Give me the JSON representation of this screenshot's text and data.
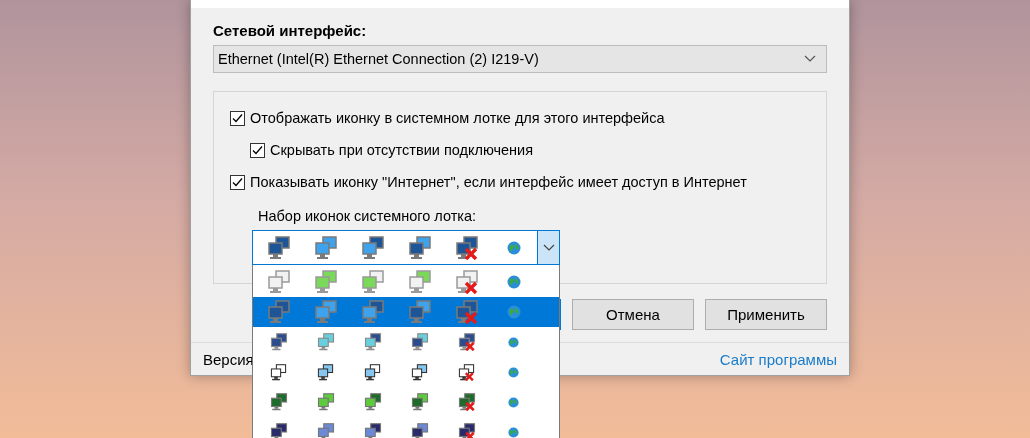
{
  "interface_section": {
    "label": "Сетевой интерфейс:",
    "select": {
      "value": "Ethernet (Intel(R) Ethernet Connection (2) I219-V)"
    }
  },
  "options": [
    {
      "label": "Отображать иконку в системном лотке для этого интерфейса",
      "checked": true,
      "children": [
        {
          "label": "Скрывать при отсутствии подключения",
          "checked": true
        }
      ]
    },
    {
      "label": "Показывать иконку \"Интернет\", если интерфейс имеет доступ в Интернет",
      "checked": true
    }
  ],
  "icon_set": {
    "label": "Набор иконок системного лотка:",
    "current": {
      "kind": "blue"
    },
    "expanded": true,
    "items": [
      {
        "kind": "light",
        "selected": false
      },
      {
        "kind": "blue",
        "selected": true
      },
      {
        "kind": "smallnet",
        "selected": false
      },
      {
        "kind": "outline",
        "selected": false
      },
      {
        "kind": "green",
        "selected": false
      },
      {
        "kind": "purple",
        "selected": false
      }
    ]
  },
  "buttons": [
    {
      "label": "Отмена"
    },
    {
      "label": "Применить"
    }
  ],
  "footer": {
    "version": "Версия",
    "link": "Сайт программы"
  }
}
